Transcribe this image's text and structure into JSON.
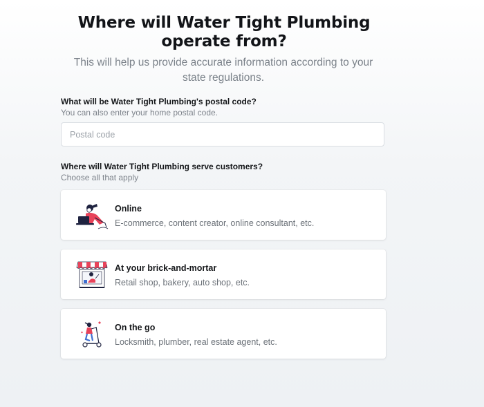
{
  "header": {
    "title_line1": "Where will Water Tight Plumbing",
    "title_line2": "operate from?",
    "subtitle_line1": "This will help us provide accurate information according to your",
    "subtitle_line2": "state regulations."
  },
  "postal_question": {
    "label": "What will be Water Tight Plumbing's postal code?",
    "hint": "You can also enter your home postal code.",
    "input_value": "",
    "placeholder": "Postal code"
  },
  "serve_question": {
    "label": "Where will Water Tight Plumbing serve customers?",
    "hint": "Choose all that apply"
  },
  "options": [
    {
      "title": "Online",
      "description": "E-commerce, content creator, online consultant, etc.",
      "icon": "laptop-person-icon"
    },
    {
      "title": "At your brick-and-mortar",
      "description": "Retail shop, bakery, auto shop, etc.",
      "icon": "storefront-icon"
    },
    {
      "title": "On the go",
      "description": "Locksmith, plumber, real estate agent, etc.",
      "icon": "scooter-person-icon"
    }
  ],
  "colors": {
    "accent": "#e8435a",
    "illustration_dark": "#1f2340",
    "illustration_blue": "#3f6fd1"
  }
}
